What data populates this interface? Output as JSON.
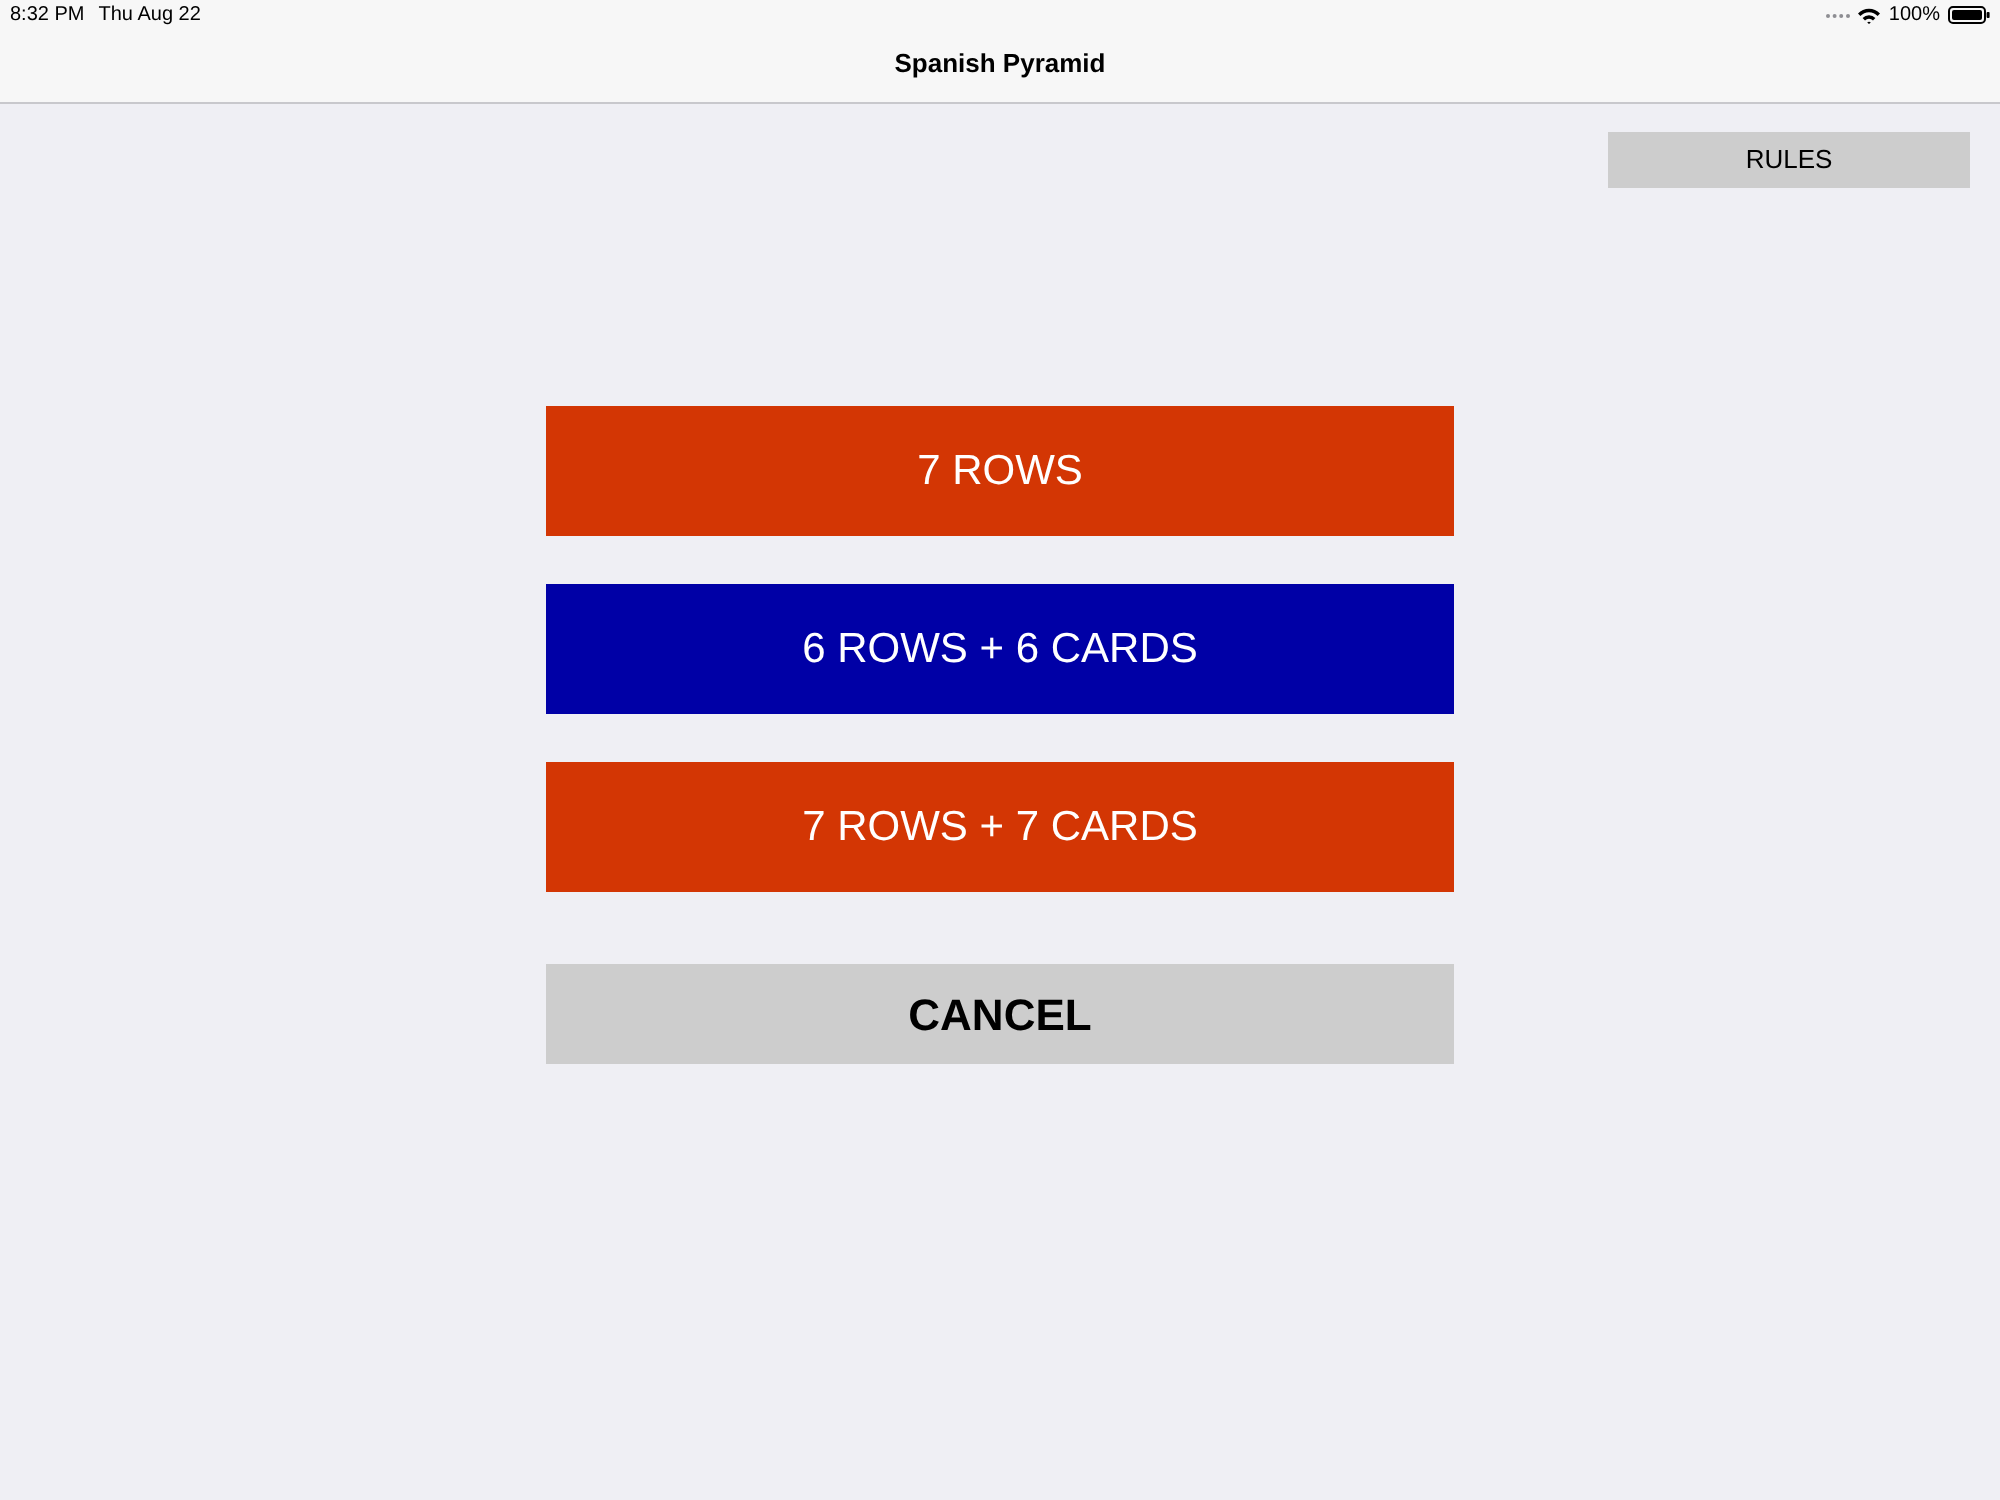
{
  "status_bar": {
    "time": "8:32 PM",
    "date": "Thu Aug 22",
    "battery": "100%"
  },
  "nav_bar": {
    "title": "Spanish Pyramid"
  },
  "rules_button": {
    "label": "RULES"
  },
  "options": [
    {
      "label": "7 ROWS",
      "color": "#d33604"
    },
    {
      "label": "6 ROWS + 6 CARDS",
      "color": "#0000a6"
    },
    {
      "label": "7 ROWS + 7 CARDS",
      "color": "#d33604"
    }
  ],
  "cancel_button": {
    "label": "CANCEL"
  }
}
